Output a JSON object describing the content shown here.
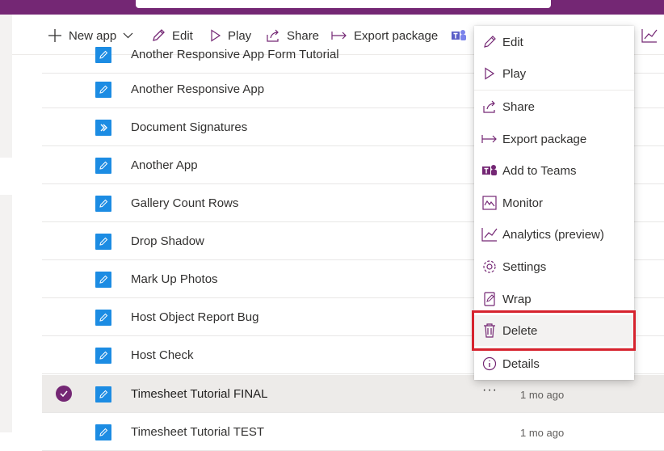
{
  "toolbar": {
    "new_app": "New app",
    "edit": "Edit",
    "play": "Play",
    "share": "Share",
    "export": "Export package"
  },
  "apps": [
    {
      "name": "Another Responsive App Form Tutorial",
      "icon": "pencil-icon"
    },
    {
      "name": "Another Responsive App",
      "icon": "pencil-icon"
    },
    {
      "name": "Document Signatures",
      "icon": "flow-icon"
    },
    {
      "name": "Another App",
      "icon": "pencil-icon"
    },
    {
      "name": "Gallery Count Rows",
      "icon": "pencil-icon"
    },
    {
      "name": "Drop Shadow",
      "icon": "pencil-icon"
    },
    {
      "name": "Mark Up Photos",
      "icon": "pencil-icon"
    },
    {
      "name": "Host Object Report Bug",
      "icon": "pencil-icon"
    },
    {
      "name": "Host Check",
      "icon": "pencil-icon"
    },
    {
      "name": "Timesheet Tutorial FINAL",
      "icon": "pencil-icon",
      "modified": "1 mo ago",
      "more": "···"
    },
    {
      "name": "Timesheet Tutorial TEST",
      "icon": "pencil-icon",
      "modified": "1 mo ago"
    }
  ],
  "menu": {
    "edit": "Edit",
    "play": "Play",
    "share": "Share",
    "export": "Export package",
    "teams": "Add to Teams",
    "monitor": "Monitor",
    "analytics": "Analytics (preview)",
    "settings": "Settings",
    "wrap": "Wrap",
    "delete": "Delete",
    "details": "Details"
  },
  "colors": {
    "brand": "#742774",
    "app_icon": "#1c8ce3",
    "highlight": "#d6232e"
  }
}
